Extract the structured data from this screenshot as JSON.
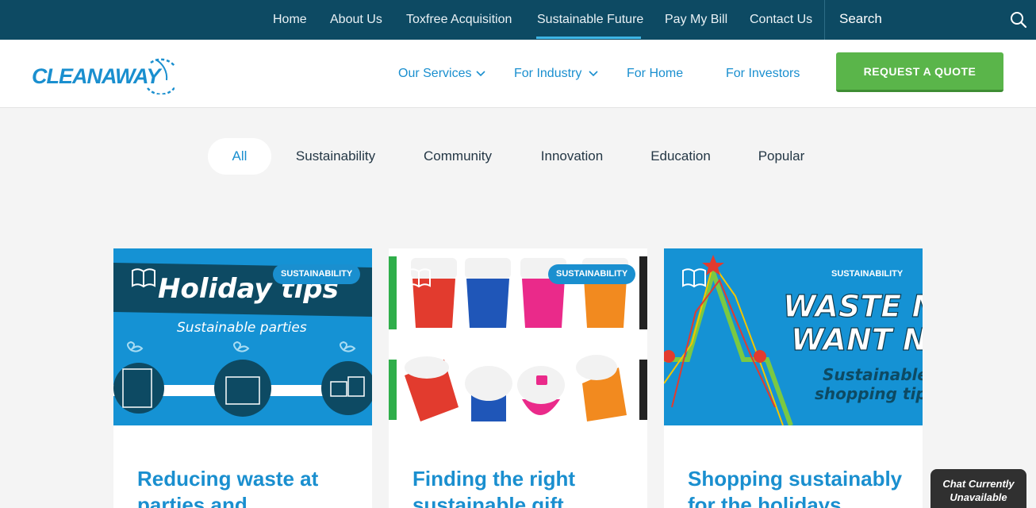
{
  "topnav": {
    "items": [
      {
        "label": "Home"
      },
      {
        "label": "About Us"
      },
      {
        "label": "Toxfree Acquisition"
      },
      {
        "label": "Sustainable Future"
      },
      {
        "label": "Pay My Bill"
      },
      {
        "label": "Contact Us"
      }
    ],
    "active": "Sustainable Future",
    "search_label": "Search"
  },
  "header": {
    "logo_text": "CLEANAWAY",
    "nav": [
      {
        "label": "Our Services",
        "has_dropdown": true
      },
      {
        "label": "For Industry",
        "has_dropdown": true
      },
      {
        "label": "For Home",
        "has_dropdown": false
      },
      {
        "label": "For Investors",
        "has_dropdown": false
      }
    ],
    "quote_button": "REQUEST A QUOTE"
  },
  "filters": {
    "items": [
      "All",
      "Sustainability",
      "Community",
      "Innovation",
      "Education",
      "Popular"
    ],
    "active": "All"
  },
  "cards": [
    {
      "badge": "SUSTAINABILITY",
      "title": "Reducing waste at parties and",
      "image": {
        "headline": "Holiday tips",
        "subheadline": "Sustainable parties"
      }
    },
    {
      "badge": "SUSTAINABILITY",
      "title": "Finding the right sustainable gift",
      "image": {
        "headline": "",
        "subheadline": ""
      }
    },
    {
      "badge": "SUSTAINABILITY",
      "title": "Shopping sustainably for the holidays",
      "image": {
        "headline_line1": "WASTE N",
        "headline_line2": "WANT NO",
        "subheadline_line1": "Sustainable",
        "subheadline_line2": "shopping tips"
      }
    }
  ],
  "chat": {
    "line1": "Chat Currently",
    "line2": "Unavailable"
  },
  "colors": {
    "topbar": "#0d4a63",
    "brand_blue": "#1a8fcf",
    "accent_cyan": "#3fb6e6",
    "quote_green": "#5ab54a",
    "card_bg_blue": "#1592d4"
  }
}
